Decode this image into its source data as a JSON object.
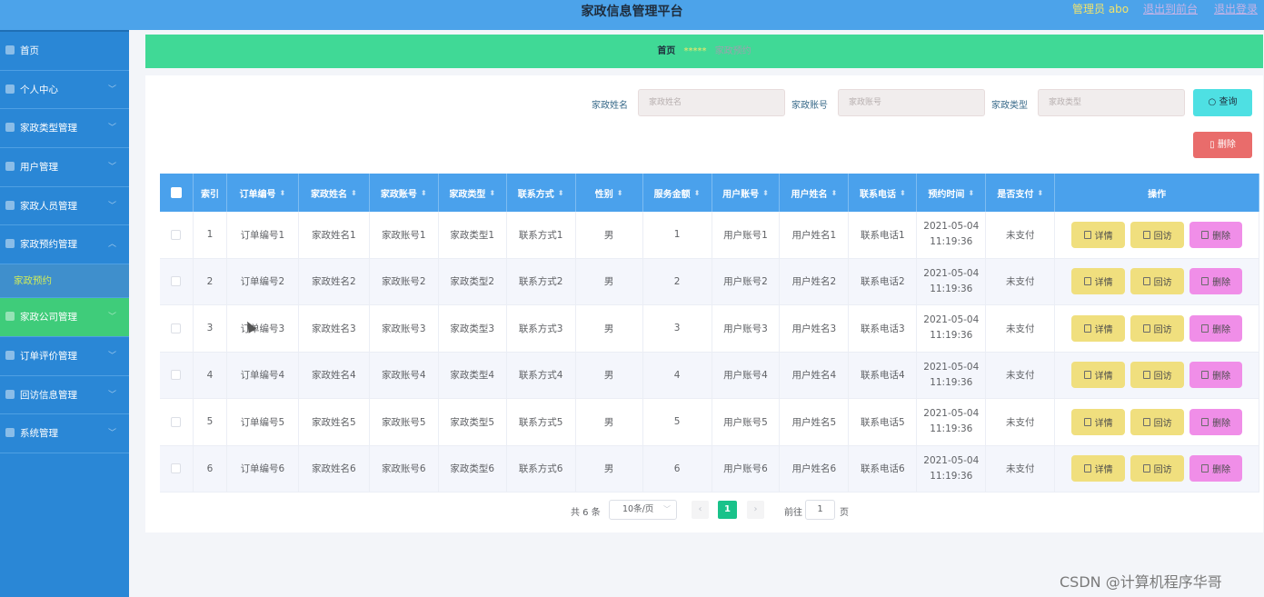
{
  "header": {
    "title": "家政信息管理平台",
    "admin": "管理员 abo",
    "link_frontend": "退出到前台",
    "link_logout": "退出登录"
  },
  "sidebar": {
    "items": [
      {
        "label": "首页",
        "chevron": ""
      },
      {
        "label": "个人中心",
        "chevron": "﹀"
      },
      {
        "label": "家政类型管理",
        "chevron": "﹀"
      },
      {
        "label": "用户管理",
        "chevron": "﹀"
      },
      {
        "label": "家政人员管理",
        "chevron": "﹀"
      },
      {
        "label": "家政预约管理",
        "chevron": "︿"
      },
      {
        "label": "家政公司管理",
        "chevron": "﹀"
      },
      {
        "label": "订单评价管理",
        "chevron": "﹀"
      },
      {
        "label": "回访信息管理",
        "chevron": "﹀"
      },
      {
        "label": "系统管理",
        "chevron": "﹀"
      }
    ],
    "sub_item": "家政预约"
  },
  "breadcrumb": {
    "home": "首页",
    "sep": "*****",
    "current": "家政预约"
  },
  "search": {
    "name_label": "家政姓名",
    "name_placeholder": "家政姓名",
    "account_label": "家政账号",
    "account_placeholder": "家政账号",
    "type_label": "家政类型",
    "type_placeholder": "家政类型",
    "query_label": "查询",
    "delete_label": "删除"
  },
  "table": {
    "columns": [
      "",
      "索引",
      "订单编号",
      "家政姓名",
      "家政账号",
      "家政类型",
      "联系方式",
      "性别",
      "服务金额",
      "用户账号",
      "用户姓名",
      "联系电话",
      "预约时间",
      "是否支付",
      "操作"
    ],
    "rows": [
      {
        "idx": "1",
        "order": "订单编号1",
        "name": "家政姓名1",
        "account": "家政账号1",
        "type": "家政类型1",
        "contact": "联系方式1",
        "gender": "男",
        "amount": "1",
        "uacc": "用户账号1",
        "uname": "用户姓名1",
        "phone": "联系电话1",
        "date": "2021-05-04",
        "time": "11:19:36",
        "paid": "未支付"
      },
      {
        "idx": "2",
        "order": "订单编号2",
        "name": "家政姓名2",
        "account": "家政账号2",
        "type": "家政类型2",
        "contact": "联系方式2",
        "gender": "男",
        "amount": "2",
        "uacc": "用户账号2",
        "uname": "用户姓名2",
        "phone": "联系电话2",
        "date": "2021-05-04",
        "time": "11:19:36",
        "paid": "未支付"
      },
      {
        "idx": "3",
        "order": "订单编号3",
        "name": "家政姓名3",
        "account": "家政账号3",
        "type": "家政类型3",
        "contact": "联系方式3",
        "gender": "男",
        "amount": "3",
        "uacc": "用户账号3",
        "uname": "用户姓名3",
        "phone": "联系电话3",
        "date": "2021-05-04",
        "time": "11:19:36",
        "paid": "未支付"
      },
      {
        "idx": "4",
        "order": "订单编号4",
        "name": "家政姓名4",
        "account": "家政账号4",
        "type": "家政类型4",
        "contact": "联系方式4",
        "gender": "男",
        "amount": "4",
        "uacc": "用户账号4",
        "uname": "用户姓名4",
        "phone": "联系电话4",
        "date": "2021-05-04",
        "time": "11:19:36",
        "paid": "未支付"
      },
      {
        "idx": "5",
        "order": "订单编号5",
        "name": "家政姓名5",
        "account": "家政账号5",
        "type": "家政类型5",
        "contact": "联系方式5",
        "gender": "男",
        "amount": "5",
        "uacc": "用户账号5",
        "uname": "用户姓名5",
        "phone": "联系电话5",
        "date": "2021-05-04",
        "time": "11:19:36",
        "paid": "未支付"
      },
      {
        "idx": "6",
        "order": "订单编号6",
        "name": "家政姓名6",
        "account": "家政账号6",
        "type": "家政类型6",
        "contact": "联系方式6",
        "gender": "男",
        "amount": "6",
        "uacc": "用户账号6",
        "uname": "用户姓名6",
        "phone": "联系电话6",
        "date": "2021-05-04",
        "time": "11:19:36",
        "paid": "未支付"
      }
    ],
    "actions": {
      "detail": "详情",
      "visit": "回访",
      "delete": "删除"
    }
  },
  "pager": {
    "total": "共 6 条",
    "size": "10条/页",
    "prev": "‹",
    "current": "1",
    "next": "›",
    "goto": "前往",
    "goto_value": "1",
    "unit": "页"
  },
  "watermark": "CSDN @计算机程序华哥"
}
